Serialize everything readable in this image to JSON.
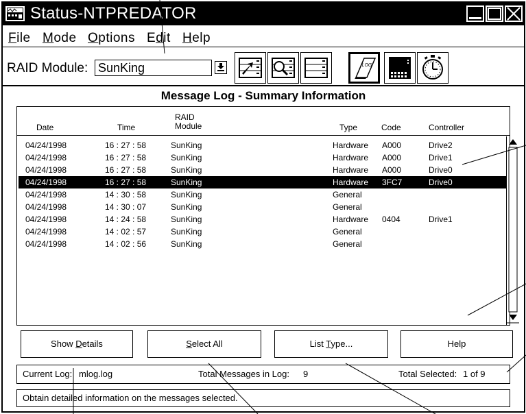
{
  "window": {
    "title": "Status-NTPREDATOR"
  },
  "menu": {
    "items": [
      "File",
      "Mode",
      "Options",
      "Edit",
      "Help"
    ]
  },
  "toolbar": {
    "raid_label": "RAID Module:",
    "raid_value": "SunKing",
    "log_icon_text": "LOG"
  },
  "panel": {
    "title": "Message Log - Summary Information"
  },
  "table": {
    "headers": {
      "date": "Date",
      "time": "Time",
      "raid_top": "RAID",
      "raid_bottom": "Module",
      "type": "Type",
      "code": "Code",
      "controller": "Controller"
    },
    "rows": [
      {
        "date": "04/24/1998",
        "time": "16 : 27 : 58",
        "module": "SunKing",
        "type": "Hardware",
        "code": "A000",
        "controller": "Drive2"
      },
      {
        "date": "04/24/1998",
        "time": "16 : 27 : 58",
        "module": "SunKing",
        "type": "Hardware",
        "code": "A000",
        "controller": "Drive1"
      },
      {
        "date": "04/24/1998",
        "time": "16 : 27 : 58",
        "module": "SunKing",
        "type": "Hardware",
        "code": "A000",
        "controller": "Drive0"
      },
      {
        "date": "04/24/1998",
        "time": "16 : 27 : 58",
        "module": "SunKing",
        "type": "Hardware",
        "code": "3FC7",
        "controller": "Drive0"
      },
      {
        "date": "04/24/1998",
        "time": "14 : 30 : 58",
        "module": "SunKing",
        "type": "General",
        "code": "",
        "controller": ""
      },
      {
        "date": "04/24/1998",
        "time": "14 : 30 : 07",
        "module": "SunKing",
        "type": "General",
        "code": "",
        "controller": ""
      },
      {
        "date": "04/24/1998",
        "time": "14 : 24 : 58",
        "module": "SunKing",
        "type": "Hardware",
        "code": "0404",
        "controller": "Drive1"
      },
      {
        "date": "04/24/1998",
        "time": "14 : 02 : 57",
        "module": "SunKing",
        "type": "General",
        "code": "",
        "controller": ""
      },
      {
        "date": "04/24/1998",
        "time": "14 : 02 : 56",
        "module": "SunKing",
        "type": "General",
        "code": "",
        "controller": ""
      }
    ],
    "selected_index": 3
  },
  "buttons": {
    "show_details": {
      "pre": "Show ",
      "mn": "D",
      "post": "etails"
    },
    "select_all": {
      "pre": "",
      "mn": "S",
      "post": "elect All"
    },
    "list_type": {
      "pre": "List ",
      "mn": "T",
      "post": "ype..."
    },
    "help": "Help"
  },
  "status": {
    "current_log_label": "Current Log:",
    "current_log_value": "mlog.log",
    "total_messages_label": "Total Messages in Log:",
    "total_messages_value": "9",
    "total_selected_label": "Total Selected:",
    "total_selected_value": "1 of 9"
  },
  "hint": {
    "text": "Obtain detailed information on the messages selected."
  }
}
